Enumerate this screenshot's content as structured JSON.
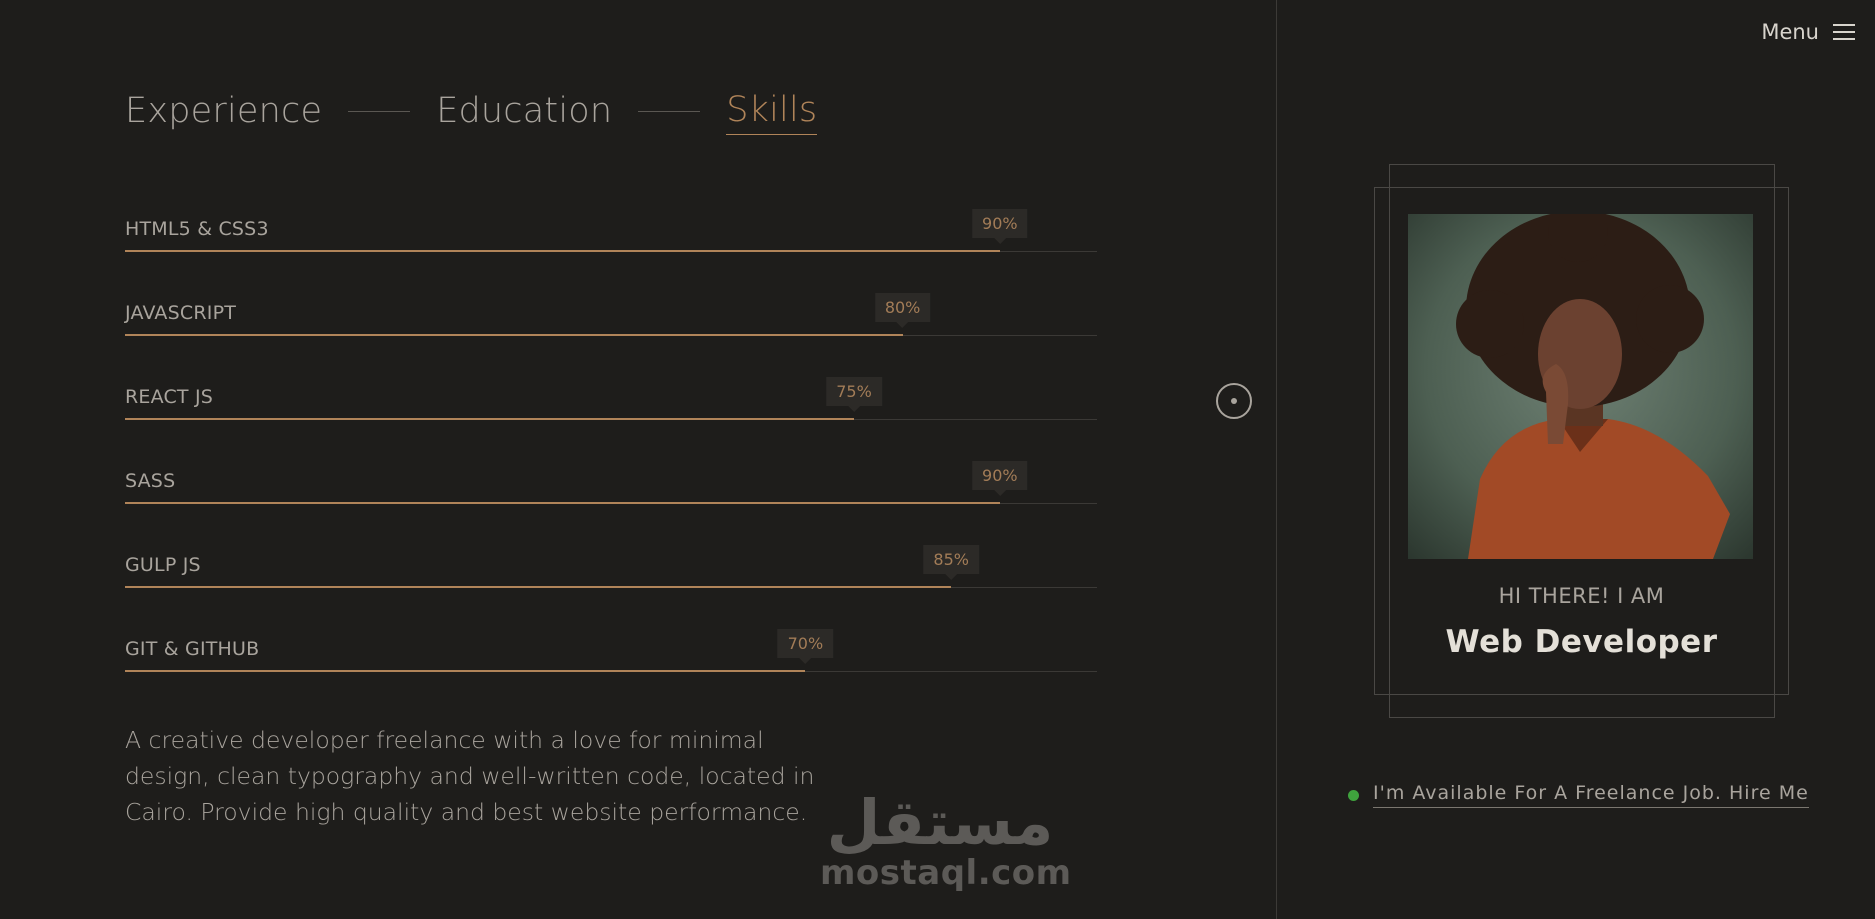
{
  "nav": {
    "tabs": [
      {
        "label": "Experience",
        "active": false
      },
      {
        "label": "Education",
        "active": false
      },
      {
        "label": "Skills",
        "active": true
      }
    ],
    "menu_label": "Menu"
  },
  "skills": [
    {
      "name": "HTML5 & CSS3",
      "percent_label": "90%",
      "value": 90
    },
    {
      "name": "JAVASCRIPT",
      "percent_label": "80%",
      "value": 80
    },
    {
      "name": "REACT JS",
      "percent_label": "75%",
      "value": 75
    },
    {
      "name": "SASS",
      "percent_label": "90%",
      "value": 90
    },
    {
      "name": "GULP JS",
      "percent_label": "85%",
      "value": 85
    },
    {
      "name": "GIT & GITHUB",
      "percent_label": "70%",
      "value": 70
    }
  ],
  "about": "A creative developer freelance with a love for minimal design, clean typography and well-written code, located in Cairo. Provide high quality and best website performance.",
  "profile": {
    "greeting": "HI THERE! I AM",
    "role": "Web Developer"
  },
  "availability": {
    "text": "I'm Available For A Freelance Job. Hire Me",
    "status_color": "#3fa23d"
  },
  "watermark": {
    "arabic": "مستقل",
    "latin": "mostaql.com"
  },
  "colors": {
    "accent": "#b08459",
    "background": "#1e1d1b"
  }
}
